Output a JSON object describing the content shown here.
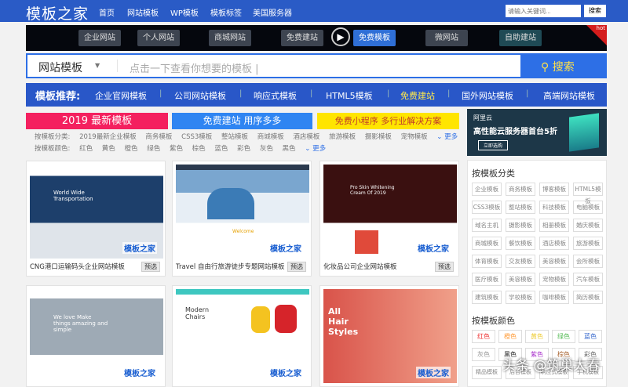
{
  "header": {
    "logo": "模板之家",
    "nav": [
      "首页",
      "网站模板",
      "WP模板",
      "模板标签",
      "美国服务器"
    ],
    "search_placeholder": "请输入关键词...",
    "search_button": "搜索"
  },
  "banner": {
    "buttons": [
      "企业网站",
      "个人网站",
      "商城网站",
      "免费建站",
      "免费模板",
      "微网站",
      "自助建站"
    ],
    "hot": "hot"
  },
  "search": {
    "type": "网站模板",
    "placeholder": "点击一下查看你想要的模板 |",
    "button": "搜索"
  },
  "recommend": {
    "title": "模板推荐:",
    "items": [
      "企业官网模板",
      "公司网站模板",
      "响应式模板",
      "HTML5模板",
      "免费建站",
      "国外网站模板",
      "高端网站模板"
    ]
  },
  "promos": [
    "2019 最新模板",
    "免费建站 用序多多",
    "免费小程序 多行业解决方案"
  ],
  "filters": {
    "category_label": "按模板分类:",
    "categories": [
      "2019最新企业模板",
      "商务模板",
      "CSS3模板",
      "整站模板",
      "商城模板",
      "酒店模板",
      "旅游模板",
      "摄影模板",
      "宠物模板"
    ],
    "color_label": "按模板颜色:",
    "colors": [
      "红色",
      "黄色",
      "橙色",
      "绿色",
      "紫色",
      "棕色",
      "蓝色",
      "彩色",
      "灰色",
      "黑色"
    ],
    "more": "更多"
  },
  "cards": [
    {
      "title": "CNG港口运输码头企业网站模板",
      "preview": "预选",
      "watermark": "模板之家"
    },
    {
      "title": "Travel 自由行旅游徒步专题网站模板",
      "preview": "预选",
      "watermark": "模板之家"
    },
    {
      "title": "化妆品公司企业网站模板",
      "preview": "预选",
      "watermark": "模板之家"
    },
    {
      "title": "",
      "preview": "",
      "watermark": "模板之家"
    },
    {
      "title": "",
      "preview": "",
      "watermark": "模板之家"
    },
    {
      "title": "",
      "preview": "",
      "watermark": "模板之家"
    }
  ],
  "thumb_text": [
    "World Wide Transportation",
    "Welcome",
    "Pro Skin Whitening Cream Of 2019",
    "We love Make things amazing and simple",
    "Modern Chairs",
    "All Hair Styles"
  ],
  "ad": {
    "brand": "阿里云",
    "headline": "高性能云服务器首台5折",
    "button": "立即选购"
  },
  "sidebar": {
    "category_title": "按模板分类",
    "categories": [
      "企业模板",
      "商务模板",
      "博客模板",
      "HTML5模板",
      "CSS3模板",
      "整站模板",
      "科技模板",
      "电脑模板",
      "域名主机",
      "摄影模板",
      "相册模板",
      "婚庆模板",
      "商城模板",
      "餐饮模板",
      "酒店模板",
      "旅游模板",
      "体育模板",
      "交友模板",
      "美容模板",
      "会所模板",
      "医疗模板",
      "美容模板",
      "宠物模板",
      "汽车模板",
      "建筑模板",
      "学校模板",
      "咖啡模板",
      "简历模板"
    ],
    "color_title": "按模板颜色",
    "colors": [
      {
        "name": "红色",
        "hex": "#e33"
      },
      {
        "name": "橙色",
        "hex": "#f93"
      },
      {
        "name": "黄色",
        "hex": "#ec3"
      },
      {
        "name": "绿色",
        "hex": "#5b5"
      },
      {
        "name": "蓝色",
        "hex": "#36c"
      },
      {
        "name": "灰色",
        "hex": "#999"
      },
      {
        "name": "黑色",
        "hex": "#222"
      },
      {
        "name": "紫色",
        "hex": "#a3c"
      },
      {
        "name": "棕色",
        "hex": "#a63"
      },
      {
        "name": "彩色",
        "hex": "#666"
      }
    ],
    "extra": [
      "精品模板",
      "后台模板",
      "响应式模板",
      "手机模板"
    ]
  },
  "watermark": "头条 @筑巢大春"
}
